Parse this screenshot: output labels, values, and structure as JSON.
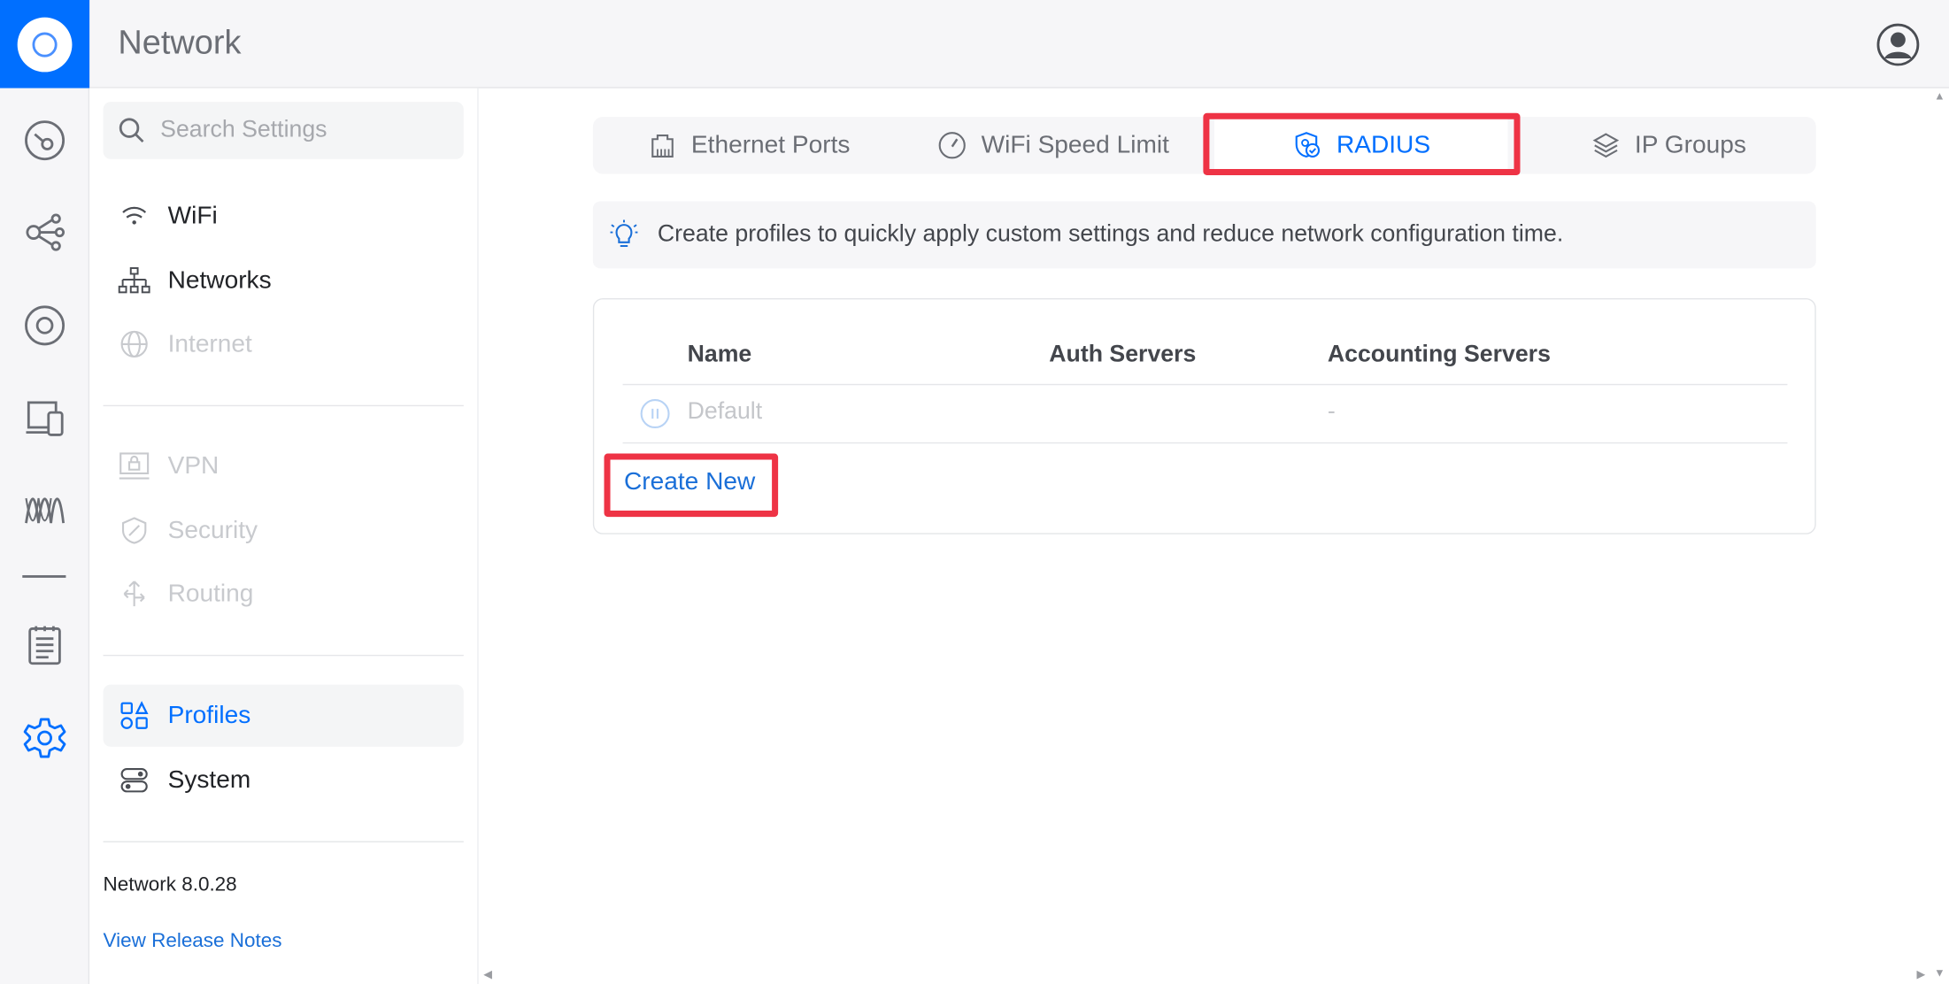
{
  "app": {
    "title": "Network"
  },
  "sidebar": {
    "search_placeholder": "Search Settings",
    "items": [
      {
        "label": "WiFi",
        "state": "normal"
      },
      {
        "label": "Networks",
        "state": "normal"
      },
      {
        "label": "Internet",
        "state": "disabled"
      },
      {
        "label": "VPN",
        "state": "disabled"
      },
      {
        "label": "Security",
        "state": "disabled"
      },
      {
        "label": "Routing",
        "state": "disabled"
      },
      {
        "label": "Profiles",
        "state": "active"
      },
      {
        "label": "System",
        "state": "normal"
      }
    ],
    "version": "Network 8.0.28",
    "release_notes": "View Release Notes"
  },
  "tabs": [
    {
      "label": "Ethernet Ports",
      "icon": "ethernet-port-icon"
    },
    {
      "label": "WiFi Speed Limit",
      "icon": "speedometer-icon"
    },
    {
      "label": "RADIUS",
      "icon": "shield-check-icon",
      "active": true
    },
    {
      "label": "IP Groups",
      "icon": "layers-icon"
    }
  ],
  "banner": {
    "text": "Create profiles to quickly apply custom settings and reduce network configuration time."
  },
  "table": {
    "headers": [
      "Name",
      "Auth Servers",
      "Accounting Servers"
    ],
    "rows": [
      {
        "name": "Default",
        "auth": "",
        "accounting": "-"
      }
    ]
  },
  "create_label": "Create New",
  "colors": {
    "accent": "#006fff",
    "highlight": "#ee3345",
    "link": "#1a6fd8"
  }
}
